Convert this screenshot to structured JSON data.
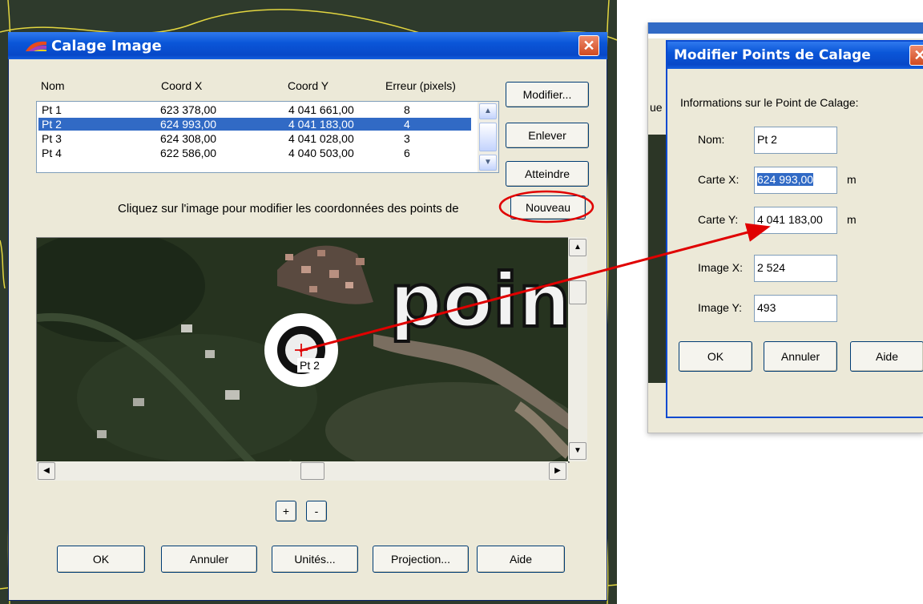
{
  "main_dialog": {
    "title": "Calage Image",
    "columns": [
      "Nom",
      "Coord X",
      "Coord Y",
      "Erreur (pixels)"
    ],
    "rows": [
      {
        "nom": "Pt 1",
        "x": "623 378,00",
        "y": "4 041 661,00",
        "err": "8",
        "selected": false
      },
      {
        "nom": "Pt 2",
        "x": "624 993,00",
        "y": "4 041 183,00",
        "err": "4",
        "selected": true
      },
      {
        "nom": "Pt 3",
        "x": "624 308,00",
        "y": "4 041 028,00",
        "err": "3",
        "selected": false
      },
      {
        "nom": "Pt 4",
        "x": "622 586,00",
        "y": "4 040 503,00",
        "err": "6",
        "selected": false
      }
    ],
    "side_buttons": {
      "modifier": "Modifier...",
      "enlever": "Enlever",
      "atteindre": "Atteindre",
      "nouveau": "Nouveau"
    },
    "instruction": "Cliquez sur l'image pour modifier les coordonnées des points de",
    "image_overlay_text": "poin",
    "point_label": "Pt 2",
    "zoom_in": "+",
    "zoom_out": "-",
    "bottom_buttons": {
      "ok": "OK",
      "annuler": "Annuler",
      "unites": "Unités...",
      "projection": "Projection...",
      "aide": "Aide"
    }
  },
  "modify_dialog": {
    "title": "Modifier Points de Calage",
    "partial_behind_text": "ue",
    "group_label": "Informations sur le Point de Calage:",
    "nom_label": "Nom:",
    "nom_value": "Pt 2",
    "carte_x_label": "Carte X:",
    "carte_x_value": "624 993,00",
    "carte_x_unit": "m",
    "carte_y_label": "Carte Y:",
    "carte_y_value": "4 041 183,00",
    "carte_y_unit": "m",
    "image_x_label": "Image X:",
    "image_x_value": "2 524",
    "image_y_label": "Image Y:",
    "image_y_value": "493",
    "buttons": {
      "ok": "OK",
      "annuler": "Annuler",
      "aide": "Aide"
    }
  },
  "colors": {
    "xp_blue": "#0a56d8",
    "selection": "#316ac5",
    "dialog_bg": "#ece9d8",
    "annotation_red": "#e00000"
  }
}
